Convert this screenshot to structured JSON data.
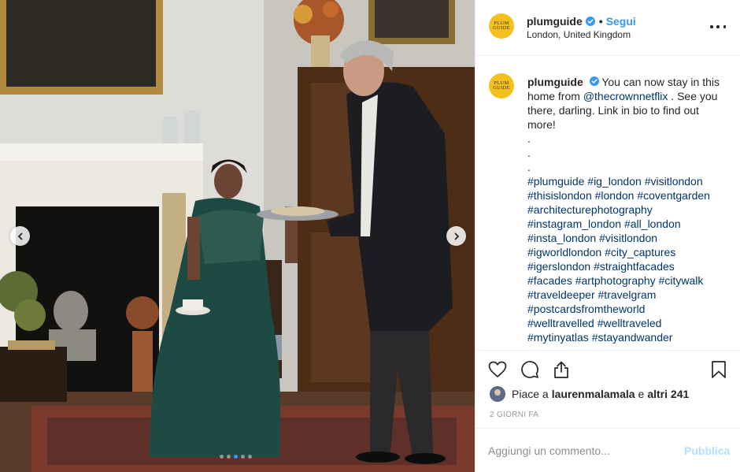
{
  "post": {
    "username": "plumguide",
    "avatar_text_1": "PLUM",
    "avatar_text_2": "GUIDE",
    "separator": "•",
    "follow_label": "Segui",
    "location": "London, United Kingdom",
    "verified": true
  },
  "caption": {
    "username": "plumguide",
    "text_part1": "You can now stay in this home from",
    "mention": "@thecrownnetflix",
    "text_part2": ". See you there, darling. Link in bio to find out more!",
    "dots": [
      ".",
      ".",
      "."
    ],
    "hashtag_lines": [
      "#plumguide #ig_london #visitlondon",
      "#thisislondon #london #coventgarden",
      "#architecturephotography",
      "#instagram_london #all_london",
      "#insta_london #visitlondon",
      "#igworldlondon #city_captures",
      "#igerslondon #straightfacades",
      "#facades #artphotography #citywalk",
      "#traveldeeper #travelgram",
      "#postcardsfromtheworld",
      "#welltravelled #welltraveled",
      "#mytinyatlas #stayandwander"
    ]
  },
  "likes": {
    "prefix": "Piace a",
    "user": "laurenmalamala",
    "connector": "e",
    "others": "altri 241"
  },
  "timestamp": "2 GIORNI FA",
  "comment": {
    "placeholder": "Aggiungi un commento...",
    "publish_label": "Pubblica"
  },
  "carousel": {
    "slide_count": 5,
    "active_index": 2
  },
  "colors": {
    "link": "#3897f0",
    "hashtag": "#003569",
    "avatar_bg": "#f4c01d",
    "publish_disabled": "#b2dffc"
  }
}
